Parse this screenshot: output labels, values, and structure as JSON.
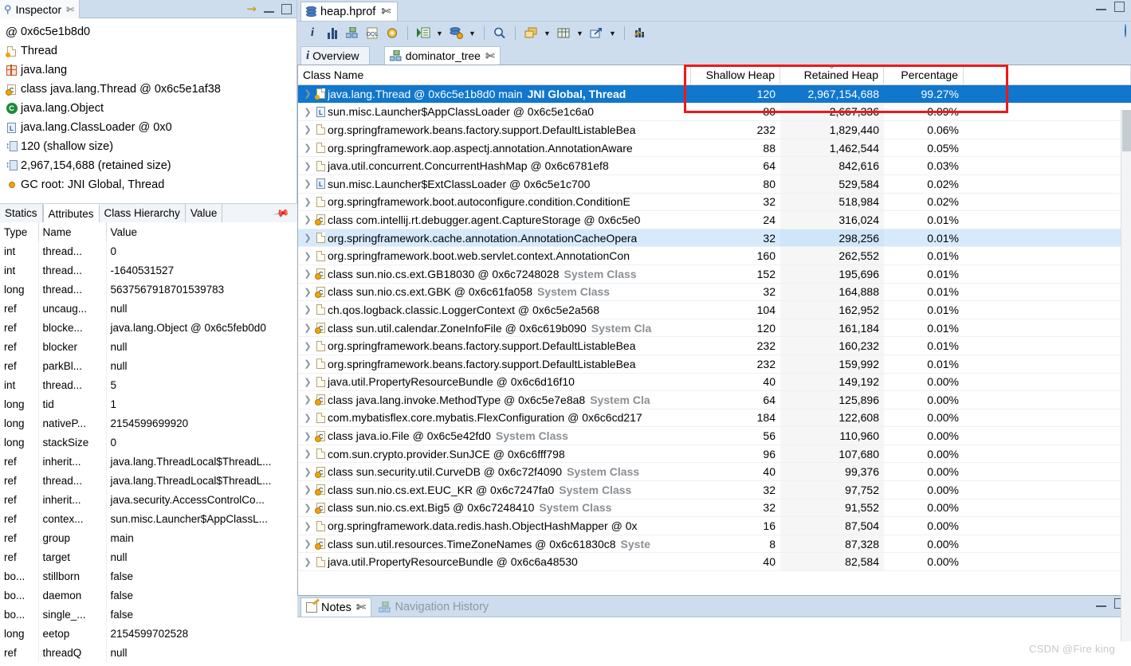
{
  "inspector": {
    "tab_title": "Inspector",
    "close_glyph": "✄",
    "items": [
      {
        "icon": "at-sign-icon",
        "glyph": "@",
        "label": "0x6c5e1b8d0",
        "type": "plain"
      },
      {
        "icon": "document-orange-icon",
        "label": "Thread",
        "type": "doc"
      },
      {
        "icon": "package-icon",
        "label": "java.lang",
        "type": "pkg"
      },
      {
        "icon": "class-icon",
        "label": "class java.lang.Thread @ 0x6c5e1af38",
        "type": "class"
      },
      {
        "icon": "green-class-icon",
        "label": "java.lang.Object",
        "type": "greenC"
      },
      {
        "icon": "classloader-icon",
        "label": "java.lang.ClassLoader @ 0x0",
        "type": "cl"
      },
      {
        "icon": "shallow-size-icon",
        "label": "120 (shallow size)",
        "type": "size"
      },
      {
        "icon": "retained-size-icon",
        "label": "2,967,154,688 (retained size)",
        "type": "size"
      },
      {
        "icon": "gc-root-icon",
        "label": "GC root: JNI Global, Thread",
        "type": "gcroot"
      }
    ],
    "attr_tabs": [
      {
        "label": "Statics",
        "active": false
      },
      {
        "label": "Attributes",
        "active": true
      },
      {
        "label": "Class Hierarchy",
        "active": false
      },
      {
        "label": "Value",
        "active": false
      }
    ],
    "pin_icon": "pin-icon",
    "attr_headers": [
      "Type",
      "Name",
      "Value"
    ],
    "attr_rows": [
      [
        "int",
        "thread...",
        "0"
      ],
      [
        "int",
        "thread...",
        "-1640531527"
      ],
      [
        "long",
        "thread...",
        "5637567918701539783"
      ],
      [
        "ref",
        "uncaug...",
        "null"
      ],
      [
        "ref",
        "blocke...",
        "java.lang.Object @ 0x6c5feb0d0"
      ],
      [
        "ref",
        "blocker",
        "null"
      ],
      [
        "ref",
        "parkBl...",
        "null"
      ],
      [
        "int",
        "thread...",
        "5"
      ],
      [
        "long",
        "tid",
        "1"
      ],
      [
        "long",
        "nativeP...",
        "2154599699920"
      ],
      [
        "long",
        "stackSize",
        "0"
      ],
      [
        "ref",
        "inherit...",
        "java.lang.ThreadLocal$ThreadL..."
      ],
      [
        "ref",
        "thread...",
        "java.lang.ThreadLocal$ThreadL..."
      ],
      [
        "ref",
        "inherit...",
        "java.security.AccessControlCo..."
      ],
      [
        "ref",
        "contex...",
        "sun.misc.Launcher$AppClassL..."
      ],
      [
        "ref",
        "group",
        "main"
      ],
      [
        "ref",
        "target",
        "null"
      ],
      [
        "bo...",
        "stillborn",
        "false"
      ],
      [
        "bo...",
        "daemon",
        "false"
      ],
      [
        "bo...",
        "single_...",
        "false"
      ],
      [
        "long",
        "eetop",
        "2154599702528"
      ],
      [
        "ref",
        "threadQ",
        "null"
      ]
    ]
  },
  "editor": {
    "tab_title": "heap.hprof",
    "tab_icon": "heap-dump-icon",
    "close_glyph": "✄",
    "toolbar": [
      {
        "name": "info-icon",
        "kind": "info"
      },
      {
        "name": "histogram-icon",
        "kind": "bars"
      },
      {
        "name": "dominator-tree-icon",
        "kind": "tree"
      },
      {
        "name": "oql-icon",
        "kind": "oql"
      },
      {
        "name": "calculate-retained-icon",
        "kind": "gear"
      },
      {
        "name": "separator",
        "kind": "sep"
      },
      {
        "name": "group-result-icon",
        "kind": "list-run",
        "arrow": true
      },
      {
        "name": "heap-query-icon",
        "kind": "db-gear",
        "arrow": true
      },
      {
        "name": "separator",
        "kind": "sep"
      },
      {
        "name": "search-icon",
        "kind": "magnifier"
      },
      {
        "name": "separator",
        "kind": "sep"
      },
      {
        "name": "copy-icon",
        "kind": "copy",
        "arrow": true
      },
      {
        "name": "table-export-icon",
        "kind": "table",
        "arrow": true
      },
      {
        "name": "export-icon",
        "kind": "export",
        "arrow": true
      },
      {
        "name": "separator",
        "kind": "sep"
      },
      {
        "name": "chart-icon",
        "kind": "chart"
      }
    ],
    "inner_tabs": [
      {
        "label": "Overview",
        "icon": "info-icon",
        "active": false
      },
      {
        "label": "dominator_tree",
        "icon": "dominator-tree-icon",
        "active": true,
        "closable": true
      }
    ],
    "columns": [
      {
        "key": "name",
        "label": "Class Name",
        "align": "left"
      },
      {
        "key": "shallow",
        "label": "Shallow Heap",
        "align": "right"
      },
      {
        "key": "retained",
        "label": "Retained Heap",
        "align": "right",
        "sort": "desc"
      },
      {
        "key": "pct",
        "label": "Percentage",
        "align": "right"
      }
    ],
    "rows": [
      {
        "icon": "thread-object-icon",
        "name": "java.lang.Thread @ 0x6c5e1b8d0  main",
        "suffix": "JNI Global, Thread",
        "shallow": "120",
        "retained": "2,967,154,688",
        "pct": "99.27%",
        "state": "selected"
      },
      {
        "icon": "classloader-icon",
        "name": "sun.misc.Launcher$AppClassLoader @ 0x6c5e1c6a0",
        "suffix": "",
        "shallow": "80",
        "retained": "2,667,336",
        "pct": "0.09%",
        "state": ""
      },
      {
        "icon": "object-icon",
        "name": "org.springframework.beans.factory.support.DefaultListableBea",
        "suffix": "",
        "shallow": "232",
        "retained": "1,829,440",
        "pct": "0.06%",
        "state": ""
      },
      {
        "icon": "object-icon",
        "name": "org.springframework.aop.aspectj.annotation.AnnotationAware",
        "suffix": "",
        "shallow": "88",
        "retained": "1,462,544",
        "pct": "0.05%",
        "state": ""
      },
      {
        "icon": "object-icon",
        "name": "java.util.concurrent.ConcurrentHashMap @ 0x6c6781ef8",
        "suffix": "",
        "shallow": "64",
        "retained": "842,616",
        "pct": "0.03%",
        "state": ""
      },
      {
        "icon": "classloader-icon",
        "name": "sun.misc.Launcher$ExtClassLoader @ 0x6c5e1c700",
        "suffix": "",
        "shallow": "80",
        "retained": "529,584",
        "pct": "0.02%",
        "state": ""
      },
      {
        "icon": "object-icon",
        "name": "org.springframework.boot.autoconfigure.condition.ConditionE",
        "suffix": "",
        "shallow": "32",
        "retained": "518,984",
        "pct": "0.02%",
        "state": ""
      },
      {
        "icon": "class-icon",
        "name": "class com.intellij.rt.debugger.agent.CaptureStorage @ 0x6c5e0",
        "suffix": "",
        "shallow": "24",
        "retained": "316,024",
        "pct": "0.01%",
        "state": ""
      },
      {
        "icon": "object-icon",
        "name": "org.springframework.cache.annotation.AnnotationCacheOpera",
        "suffix": "",
        "shallow": "32",
        "retained": "298,256",
        "pct": "0.01%",
        "state": "hl"
      },
      {
        "icon": "object-icon",
        "name": "org.springframework.boot.web.servlet.context.AnnotationCon",
        "suffix": "",
        "shallow": "160",
        "retained": "262,552",
        "pct": "0.01%",
        "state": ""
      },
      {
        "icon": "class-icon",
        "name": "class sun.nio.cs.ext.GB18030 @ 0x6c7248028",
        "suffix": "System Class",
        "shallow": "152",
        "retained": "195,696",
        "pct": "0.01%",
        "state": ""
      },
      {
        "icon": "class-icon",
        "name": "class sun.nio.cs.ext.GBK @ 0x6c61fa058",
        "suffix": "System Class",
        "shallow": "32",
        "retained": "164,888",
        "pct": "0.01%",
        "state": ""
      },
      {
        "icon": "object-icon",
        "name": "ch.qos.logback.classic.LoggerContext @ 0x6c5e2a568",
        "suffix": "",
        "shallow": "104",
        "retained": "162,952",
        "pct": "0.01%",
        "state": ""
      },
      {
        "icon": "class-icon",
        "name": "class sun.util.calendar.ZoneInfoFile @ 0x6c619b090",
        "suffix": "System Cla",
        "shallow": "120",
        "retained": "161,184",
        "pct": "0.01%",
        "state": ""
      },
      {
        "icon": "object-icon",
        "name": "org.springframework.beans.factory.support.DefaultListableBea",
        "suffix": "",
        "shallow": "232",
        "retained": "160,232",
        "pct": "0.01%",
        "state": ""
      },
      {
        "icon": "object-icon",
        "name": "org.springframework.beans.factory.support.DefaultListableBea",
        "suffix": "",
        "shallow": "232",
        "retained": "159,992",
        "pct": "0.01%",
        "state": ""
      },
      {
        "icon": "object-icon",
        "name": "java.util.PropertyResourceBundle @ 0x6c6d16f10",
        "suffix": "",
        "shallow": "40",
        "retained": "149,192",
        "pct": "0.00%",
        "state": ""
      },
      {
        "icon": "class-icon",
        "name": "class java.lang.invoke.MethodType @ 0x6c5e7e8a8",
        "suffix": "System Cla",
        "shallow": "64",
        "retained": "125,896",
        "pct": "0.00%",
        "state": ""
      },
      {
        "icon": "object-icon",
        "name": "com.mybatisflex.core.mybatis.FlexConfiguration @ 0x6c6cd217",
        "suffix": "",
        "shallow": "184",
        "retained": "122,608",
        "pct": "0.00%",
        "state": ""
      },
      {
        "icon": "class-icon",
        "name": "class java.io.File @ 0x6c5e42fd0",
        "suffix": "System Class",
        "shallow": "56",
        "retained": "110,960",
        "pct": "0.00%",
        "state": ""
      },
      {
        "icon": "object-icon",
        "name": "com.sun.crypto.provider.SunJCE @ 0x6c6fff798",
        "suffix": "",
        "shallow": "96",
        "retained": "107,680",
        "pct": "0.00%",
        "state": ""
      },
      {
        "icon": "class-icon",
        "name": "class sun.security.util.CurveDB @ 0x6c72f4090",
        "suffix": "System Class",
        "shallow": "40",
        "retained": "99,376",
        "pct": "0.00%",
        "state": ""
      },
      {
        "icon": "class-icon",
        "name": "class sun.nio.cs.ext.EUC_KR @ 0x6c7247fa0",
        "suffix": "System Class",
        "shallow": "32",
        "retained": "97,752",
        "pct": "0.00%",
        "state": ""
      },
      {
        "icon": "class-icon",
        "name": "class sun.nio.cs.ext.Big5 @ 0x6c7248410",
        "suffix": "System Class",
        "shallow": "32",
        "retained": "91,552",
        "pct": "0.00%",
        "state": ""
      },
      {
        "icon": "object-icon",
        "name": "org.springframework.data.redis.hash.ObjectHashMapper @ 0x",
        "suffix": "",
        "shallow": "16",
        "retained": "87,504",
        "pct": "0.00%",
        "state": ""
      },
      {
        "icon": "class-icon",
        "name": "class sun.util.resources.TimeZoneNames @ 0x6c61830c8",
        "suffix": "Syste",
        "shallow": "8",
        "retained": "87,328",
        "pct": "0.00%",
        "state": ""
      },
      {
        "icon": "object-icon",
        "name": "java.util.PropertyResourceBundle @ 0x6c6a48530",
        "suffix": "",
        "shallow": "40",
        "retained": "82,584",
        "pct": "0.00%",
        "state": ""
      }
    ]
  },
  "notes": {
    "tabs": [
      {
        "label": "Notes",
        "icon": "notes-icon",
        "active": true,
        "closable": true
      },
      {
        "label": "Navigation History",
        "icon": "navigation-history-icon",
        "active": false,
        "closable": false
      }
    ]
  },
  "watermark": "CSDN @Fire king",
  "colors": {
    "selection_blue": "#1077cd",
    "highlight_row": "#d6eafc",
    "annotation_red": "#f01818",
    "tab_background": "#cdddee"
  }
}
